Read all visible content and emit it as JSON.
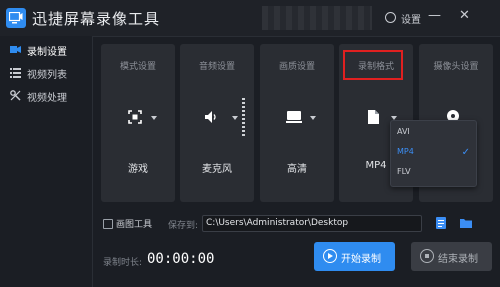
{
  "app": {
    "title": "迅捷屏幕录像工具",
    "settings_label": "设置",
    "minimize_glyph": "—",
    "close_glyph": "✕"
  },
  "sidebar": {
    "items": [
      {
        "label": "录制设置",
        "icon": "video-camera-icon",
        "active": true
      },
      {
        "label": "视频列表",
        "icon": "list-icon",
        "active": false
      },
      {
        "label": "视频处理",
        "icon": "tools-icon",
        "active": false
      }
    ]
  },
  "panels": [
    {
      "title": "模式设置",
      "value": "游戏",
      "icon": "fullscreen-select-icon"
    },
    {
      "title": "音频设置",
      "value": "麦克风",
      "icon": "speaker-icon"
    },
    {
      "title": "画质设置",
      "value": "高清",
      "icon": "monitor-icon"
    },
    {
      "title": "录制格式",
      "value": "MP4",
      "icon": "file-icon",
      "highlighted": true
    },
    {
      "title": "摄像头设置",
      "value": "",
      "icon": "webcam-icon"
    }
  ],
  "format_dropdown": {
    "options": [
      "AVI",
      "MP4",
      "FLV"
    ],
    "selected": "MP4",
    "check_glyph": "✓"
  },
  "bottom": {
    "draw_tool_label": "画图工具",
    "save_to_label": "保存到:",
    "save_path": "C:\\Users\\Administrator\\Desktop",
    "duration_label": "录制时长:",
    "duration": "00:00:00",
    "start_label": "开始录制",
    "stop_label": "结束录制"
  },
  "colors": {
    "accent": "#2f8cf0",
    "highlight": "#e02020",
    "background": "#1b1e24",
    "panel": "#2a2d33"
  }
}
